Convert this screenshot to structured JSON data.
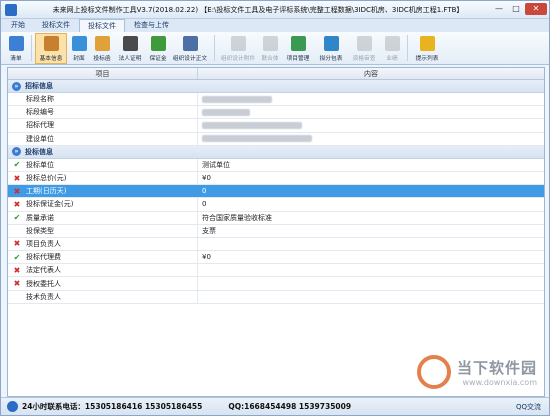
{
  "window": {
    "title": "未来网上投标文件制作工具V3.7(2018.02.22) 【E:\\投标文件工具及电子评标系统\\完整工程数据\\3IDC机房、3IDC机房工程1.FTB】"
  },
  "tabs": [
    "开始",
    "投标文件",
    "投标文件",
    "检查与上传"
  ],
  "toolbar": {
    "items": [
      {
        "label": "清单",
        "icon": "list-icon",
        "color": "#3d7fd4"
      },
      {
        "label": "基本信息",
        "icon": "info-icon",
        "color": "#c7802f"
      },
      {
        "label": "封面",
        "icon": "cover-icon",
        "color": "#3a8fd9"
      },
      {
        "label": "投标函",
        "icon": "letter-icon",
        "color": "#e0a03a"
      },
      {
        "label": "法人证明",
        "icon": "person-icon",
        "color": "#4a4a4a"
      },
      {
        "label": "保证金",
        "icon": "money-icon",
        "color": "#3f9a3a"
      },
      {
        "label": "组织设计正文",
        "icon": "edit-icon",
        "color": "#4d6fa6"
      },
      {
        "label": "组织设计附件",
        "icon": "attach-icon",
        "color": "#8c9299"
      },
      {
        "label": "联合体",
        "icon": "union-icon",
        "color": "#8c9299"
      },
      {
        "label": "项目管理",
        "icon": "project-icon",
        "color": "#3a9a52"
      },
      {
        "label": "拟分包表",
        "icon": "chart-icon",
        "color": "#2f86c9"
      },
      {
        "label": "资格审查",
        "icon": "check-icon",
        "color": "#8c9299"
      },
      {
        "label": "业绩",
        "icon": "trophy-icon",
        "color": "#8c9299"
      },
      {
        "label": "提示列表",
        "icon": "warning-icon",
        "color": "#e9b21f"
      }
    ]
  },
  "grid": {
    "col_item": "项目",
    "col_content": "内容",
    "sections": [
      {
        "title": "招标信息",
        "rows": [
          {
            "label": "标段名称",
            "value": "",
            "mark": "none"
          },
          {
            "label": "标段编号",
            "value": "",
            "mark": "none"
          },
          {
            "label": "招标代理",
            "value": "",
            "mark": "none"
          },
          {
            "label": "建设单位",
            "value": "",
            "mark": "none"
          }
        ]
      },
      {
        "title": "投标信息",
        "rows": [
          {
            "label": "投标单位",
            "value": "测试单位",
            "mark": "ok"
          },
          {
            "label": "投标总价(元)",
            "value": "¥0",
            "mark": "bad"
          },
          {
            "label": "工期(日历天)",
            "value": "0",
            "mark": "bad",
            "selected": true
          },
          {
            "label": "投标保证金(元)",
            "value": "0",
            "mark": "bad"
          },
          {
            "label": "质量承诺",
            "value": "符合国家质量验收标准",
            "mark": "ok"
          },
          {
            "label": "投保类型",
            "value": "支票",
            "mark": "none"
          },
          {
            "label": "项目负责人",
            "value": "",
            "mark": "bad"
          },
          {
            "label": "投标代理费",
            "value": "¥0",
            "mark": "ok"
          },
          {
            "label": "法定代表人",
            "value": "",
            "mark": "bad"
          },
          {
            "label": "授权委托人",
            "value": "",
            "mark": "bad"
          },
          {
            "label": "技术负责人",
            "value": "",
            "mark": "none"
          }
        ]
      }
    ]
  },
  "status": {
    "phone": "24小时联系电话：15305186416 15305186455",
    "qq": "QQ:1668454498 1539735009",
    "right": "QQ交流"
  },
  "watermark": {
    "text": "当下软件园",
    "url": "www.downxia.com"
  }
}
